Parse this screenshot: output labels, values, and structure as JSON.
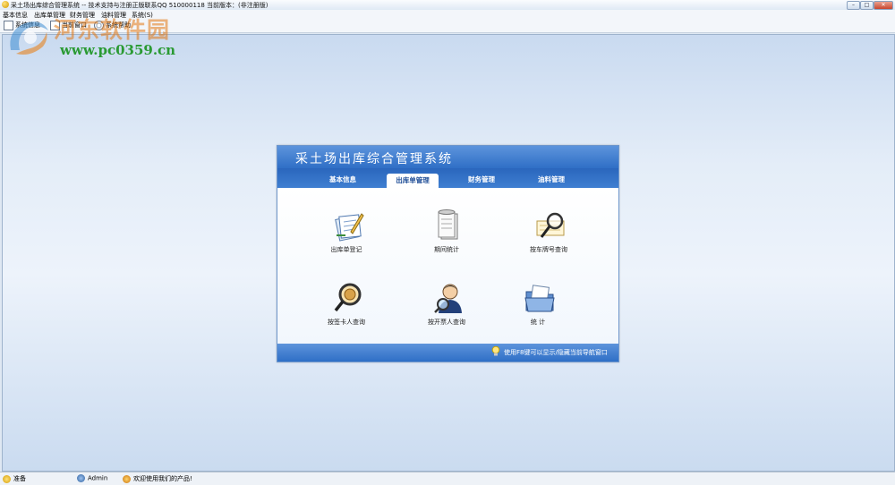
{
  "window": {
    "title": "采土场出库综合管理系统 -- 技术支持与注册正版联系QQ 510000118   当前版本：(非注册版)",
    "controls": [
      "–",
      "□",
      "✕"
    ]
  },
  "menu": [
    "基本信息",
    "出库单管理",
    "财务管理",
    "油料管理",
    "系统(S)"
  ],
  "toolbar": {
    "buttons": [
      {
        "label": "系统信息",
        "icon": "window-icon"
      },
      {
        "label": "当前窗口",
        "icon": "window-icon"
      },
      {
        "label": "系统帮助",
        "icon": "help-icon"
      }
    ]
  },
  "watermark": {
    "brand": "河东软件园",
    "url": "www.pc0359.cn"
  },
  "panel": {
    "title": "采土场出库综合管理系统",
    "tabs": [
      "基本信息",
      "出库单管理",
      "财务管理",
      "油料管理"
    ],
    "active_tab": "出库单管理",
    "tiles": [
      {
        "label": "出库单登记",
        "icon": "register-document-icon"
      },
      {
        "label": "期间统计",
        "icon": "scroll-statistics-icon"
      },
      {
        "label": "按车牌号查询",
        "icon": "magnifier-document-icon"
      },
      {
        "label": "按签卡人查询",
        "icon": "magnifier-coin-icon"
      },
      {
        "label": "按开票人查询",
        "icon": "person-search-icon"
      },
      {
        "label": "统      计",
        "icon": "folder-documents-icon"
      }
    ],
    "hint": "使用F8键可以显示/隐藏当前导航窗口"
  },
  "status": {
    "state": "准备",
    "user": "Admin",
    "welcome": "欢迎使用我们的产品!"
  },
  "colors": {
    "panel_header": "#2f6fc6",
    "workspace": "#dfe8f3",
    "watermark_brand": "#e17814",
    "watermark_url": "#2a9a33"
  }
}
